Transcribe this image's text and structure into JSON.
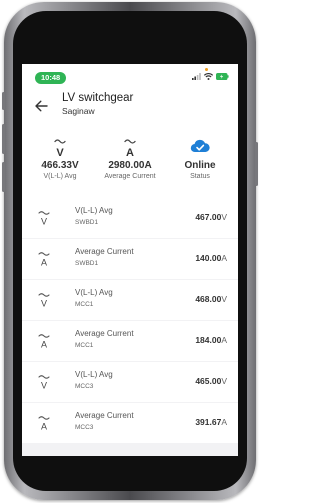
{
  "status_bar": {
    "time": "10:48"
  },
  "header": {
    "title": "LV switchgear",
    "subtitle": "Saginaw"
  },
  "summary": {
    "voltage": {
      "symbol": "V",
      "value": "466.33V",
      "label": "V(L-L) Avg"
    },
    "current": {
      "symbol": "A",
      "value": "2980.00A",
      "label": "Average Current"
    },
    "status": {
      "value": "Online",
      "label": "Status"
    }
  },
  "measurements": [
    {
      "symbol": "V",
      "title": "V(L-L) Avg",
      "device": "SWBD1",
      "value": "467.00",
      "unit": "V"
    },
    {
      "symbol": "A",
      "title": "Average Current",
      "device": "SWBD1",
      "value": "140.00",
      "unit": "A"
    },
    {
      "symbol": "V",
      "title": "V(L-L) Avg",
      "device": "MCC1",
      "value": "468.00",
      "unit": "V"
    },
    {
      "symbol": "A",
      "title": "Average Current",
      "device": "MCC1",
      "value": "184.00",
      "unit": "A"
    },
    {
      "symbol": "V",
      "title": "V(L-L) Avg",
      "device": "MCC3",
      "value": "465.00",
      "unit": "V"
    },
    {
      "symbol": "A",
      "title": "Average Current",
      "device": "MCC3",
      "value": "391.67",
      "unit": "A"
    }
  ],
  "colors": {
    "time_pill": "#2fb455",
    "cloud_check": "#1e7fd6",
    "battery": "#2fb455",
    "wifi": "#333333"
  },
  "icons": {
    "back": "arrow-left-icon",
    "voltage": "ac-voltage-icon",
    "current": "ac-current-icon",
    "online": "cloud-check-icon"
  }
}
